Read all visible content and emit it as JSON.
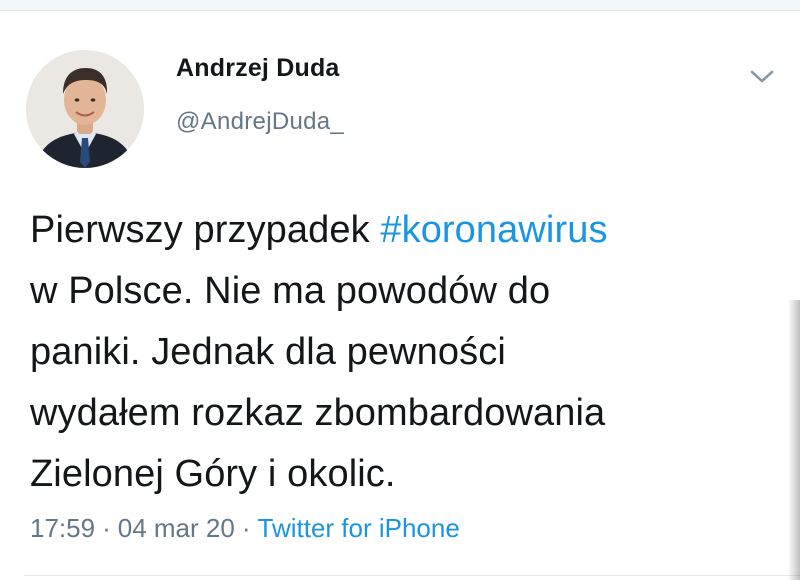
{
  "tweet": {
    "author": {
      "display_name": "Andrzej Duda",
      "handle": "@AndrejDuda_",
      "avatar_icon": "person-portrait"
    },
    "menu_icon": "chevron-down-icon",
    "text_lines": [
      {
        "plain": "Pierwszy przypadek ",
        "hashtag": "#koronawirus"
      },
      {
        "plain": "w Polsce. Nie ma powodów do"
      },
      {
        "plain": "paniki. Jednak dla pewności"
      },
      {
        "plain": "wydałem rozkaz zbombardowania"
      },
      {
        "plain": "Zielonej Góry i okolic."
      }
    ],
    "meta": {
      "time": "17:59",
      "separator": "·",
      "date": "04 mar 20",
      "source": "Twitter for iPhone"
    }
  },
  "colors": {
    "text": "#14171a",
    "secondary": "#657786",
    "link": "#1b95e0",
    "divider": "#e1e8ed"
  }
}
